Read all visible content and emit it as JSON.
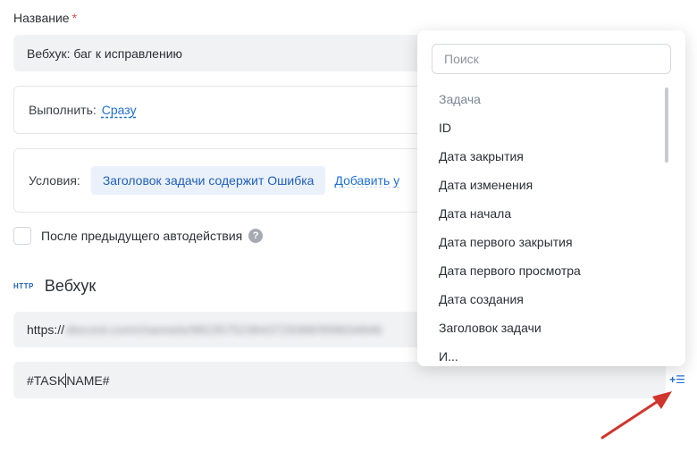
{
  "form": {
    "name_label": "Название",
    "required_mark": "*",
    "name_value": "Вебхук: баг к исправлению",
    "execute_label": "Выполнить:",
    "execute_value": "Сразу",
    "conditions_label": "Условия:",
    "condition_chip": "Заголовок задачи содержит Ошибка",
    "add_condition": "Добавить у",
    "after_previous": "После предыдущего автодействия",
    "help_glyph": "?"
  },
  "webhook": {
    "icon_text": "HTTP",
    "title": "Вебхук",
    "url_prefix": "https://",
    "url_blurred": "discord.com/channels/982357523643729368/958634846",
    "body_before_caret": "#TASK",
    "body_after_caret": "NAME#",
    "insert_glyph": "+☰"
  },
  "dropdown": {
    "search_placeholder": "Поиск",
    "group_label": "Задача",
    "items": [
      "ID",
      "Дата закрытия",
      "Дата изменения",
      "Дата начала",
      "Дата первого закрытия",
      "Дата первого просмотра",
      "Дата создания",
      "Заголовок задачи",
      "И..."
    ]
  },
  "colors": {
    "accent": "#1f6fd1",
    "arrow": "#d0342c",
    "required": "#e5484d"
  }
}
